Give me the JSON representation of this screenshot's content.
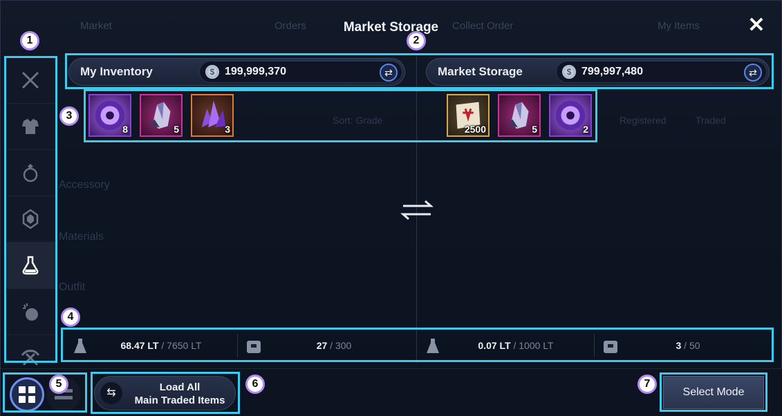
{
  "window": {
    "title": "Market Storage",
    "background_tabs": [
      "Market",
      "Orders",
      "Collect Order",
      "My Items"
    ],
    "background_sort": "Sort: Grade",
    "background_filters": [
      "Registered",
      "Traded"
    ],
    "background_categories": [
      "Accessory",
      "Materials",
      "Outfit"
    ]
  },
  "sidebar": {
    "items": [
      {
        "icon": "crossed-swords-icon"
      },
      {
        "icon": "armor-icon"
      },
      {
        "icon": "ring-icon"
      },
      {
        "icon": "gem-icon"
      },
      {
        "icon": "potion-icon",
        "active": true
      },
      {
        "icon": "bomb-icon"
      },
      {
        "icon": "pickaxe-hammer-icon"
      }
    ]
  },
  "inventory": {
    "label": "My Inventory",
    "currency": "199,999,370",
    "items": [
      {
        "name": "purple-orb",
        "qty": "8",
        "grade_color": "#8a3fd6"
      },
      {
        "name": "crystal-ore",
        "qty": "5",
        "grade_color": "#d0309a"
      },
      {
        "name": "amethyst-cluster",
        "qty": "3",
        "grade_color": "#e07a3a"
      }
    ],
    "weight": "68.47 LT",
    "weight_max": "7650 LT",
    "slots": "27",
    "slots_max": "300"
  },
  "storage": {
    "label": "Market Storage",
    "currency": "799,997,480",
    "items": [
      {
        "name": "scroll",
        "qty": "2500",
        "grade_color": "#d8a84a"
      },
      {
        "name": "crystal-ore",
        "qty": "5",
        "grade_color": "#d0309a"
      },
      {
        "name": "purple-orb",
        "qty": "2",
        "grade_color": "#8a3fd6"
      }
    ],
    "weight": "0.07 LT",
    "weight_max": "1000 LT",
    "slots": "3",
    "slots_max": "50"
  },
  "bottom": {
    "load_line1": "Load All",
    "load_line2": "Main Traded Items",
    "select_mode": "Select Mode"
  },
  "badges": [
    "1",
    "2",
    "3",
    "4",
    "5",
    "6",
    "7"
  ],
  "colors": {
    "highlight": "#3fc9ec",
    "badge_border": "#b08cf0",
    "accent_blue": "#5a86e8"
  }
}
